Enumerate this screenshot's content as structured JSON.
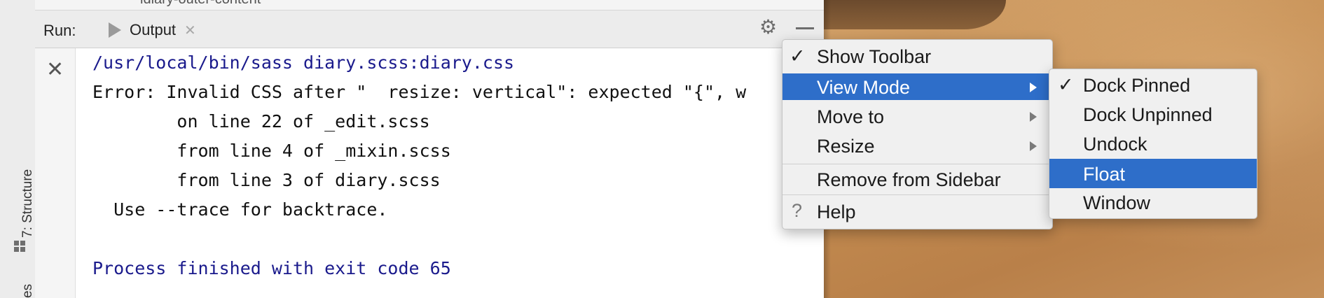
{
  "window": {
    "top_fragment": "ldiary-outer-content",
    "run_label": "Run:",
    "tab": {
      "label": "Output",
      "close": "✕"
    },
    "sidebar": {
      "structure_label": "7: Structure",
      "bottom_label": "es"
    }
  },
  "console": {
    "lines": [
      "/usr/local/bin/sass diary.scss:diary.css",
      "Error: Invalid CSS after \"  resize: vertical\": expected \"{\", w",
      "        on line 22 of _edit.scss",
      "        from line 4 of _mixin.scss",
      "        from line 3 of diary.scss",
      "  Use --trace for backtrace.",
      "",
      "Process finished with exit code 65"
    ]
  },
  "context_menu": {
    "items": [
      {
        "label": "Show Toolbar",
        "checked": true
      },
      {
        "label": "View Mode",
        "submenu": true,
        "selected": true
      },
      {
        "label": "Move to",
        "submenu": true
      },
      {
        "label": "Resize",
        "submenu": true
      },
      {
        "label": "Remove from Sidebar"
      },
      {
        "label": "Help",
        "icon": "?"
      }
    ]
  },
  "view_mode_submenu": {
    "items": [
      {
        "label": "Dock Pinned",
        "checked": true
      },
      {
        "label": "Dock Unpinned"
      },
      {
        "label": "Undock"
      },
      {
        "label": "Float",
        "selected": true
      },
      {
        "label": "Window"
      }
    ]
  },
  "icons": {
    "checkmark": "✓",
    "stop": "✕",
    "gear": "⚙"
  },
  "colors": {
    "selection": "#2e6ec9",
    "console_path": "#1a1a8c"
  }
}
